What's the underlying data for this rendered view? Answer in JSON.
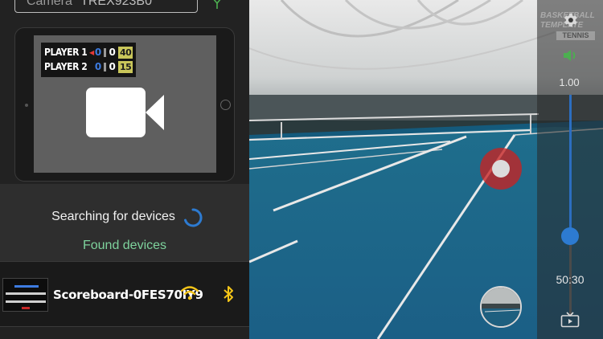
{
  "camera_field": {
    "label": "Camera",
    "value": "TREX923B0"
  },
  "scoreboard_preview": {
    "players": [
      {
        "name": "PLAYER 1",
        "games": "0",
        "sets": "0",
        "points": "40",
        "serving": true
      },
      {
        "name": "PLAYER 2",
        "games": "0",
        "sets": "0",
        "points": "15",
        "serving": false
      }
    ]
  },
  "search": {
    "status_text": "Searching for devices",
    "found_label": "Found devices"
  },
  "devices": [
    {
      "name": "Scoreboard-0FES70IY9",
      "wifi_icon": "wifi-icon",
      "bluetooth_icon": "bluetooth-icon"
    }
  ],
  "camera_overlay": {
    "brand_line1": "BASKETBALL",
    "brand_line2": "TEMPLATE",
    "brand_tag": "TENNIS",
    "zoom": "1.00",
    "zoom_level_fraction": 0.62,
    "timer": "50:30"
  },
  "colors": {
    "accent_blue": "#2d7bd1",
    "found_green": "#7ed39d",
    "record_red": "#c82222",
    "icon_yellow": "#f5c518",
    "volume_green": "#4caf50"
  }
}
